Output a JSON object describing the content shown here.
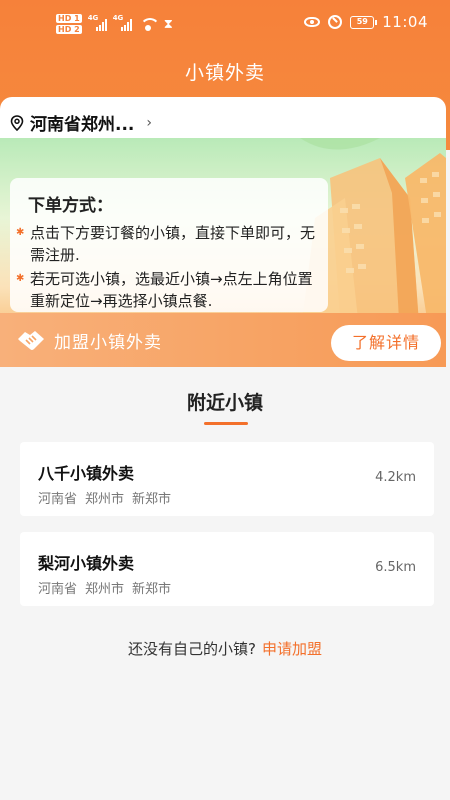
{
  "status_bar": {
    "hd1": "HD 1",
    "hd2": "HD 2",
    "net1": "4G",
    "net2": "4G",
    "battery": "59",
    "time": "11:04"
  },
  "header": {
    "title": "小镇外卖"
  },
  "location": {
    "text": "河南省郑州..."
  },
  "banner": {
    "notice_title": "下单方式：",
    "rule1": "点击下方要订餐的小镇，直接下单即可，无需注册.",
    "rule2": "若无可选小镇，选最近小镇→点左上角位置重新定位→再选择小镇点餐."
  },
  "join": {
    "text": "加盟小镇外卖",
    "button": "了解详情"
  },
  "nearby": {
    "title": "附近小镇",
    "towns": [
      {
        "name": "八千小镇外卖",
        "province": "河南省",
        "city": "郑州市",
        "district": "新郑市",
        "distance": "4.2km"
      },
      {
        "name": "梨河小镇外卖",
        "province": "河南省",
        "city": "郑州市",
        "district": "新郑市",
        "distance": "6.5km"
      }
    ]
  },
  "footer": {
    "question": "还没有自己的小镇?",
    "link": "申请加盟"
  },
  "colors": {
    "accent": "#f3702b",
    "header": "#f6813a"
  }
}
